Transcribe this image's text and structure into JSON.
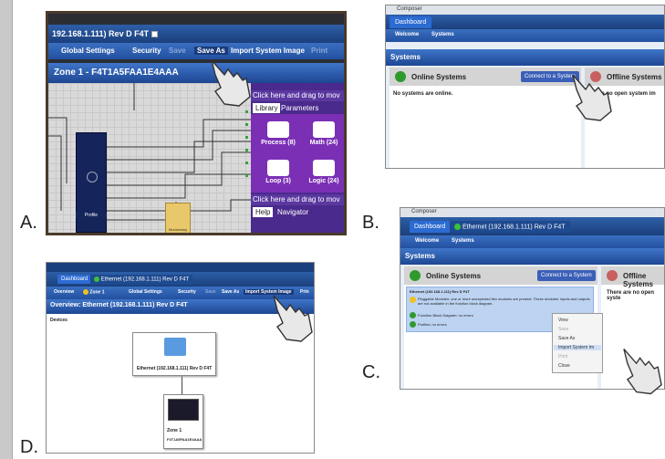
{
  "panel_letters": [
    "A.",
    "B.",
    "C.",
    "D."
  ],
  "panel_a": {
    "tab": "192.168.1.111) Rev D F4T",
    "menu": [
      "Global Settings",
      "Security",
      "Save",
      "Save As",
      "Import System Image",
      "Print"
    ],
    "zone_title": "Zone 1 - F4T1A5FAA1E4AAA",
    "drag_hint": "Click here and drag to mov",
    "lib_tab": "Library",
    "params_tab": "Parameters",
    "items": [
      "Process (8)",
      "Math (24)",
      "Loop (3)",
      "Logic (24)"
    ],
    "drag_hint2": "Click here and drag to mov",
    "help_tab": "Help",
    "nav_tab": "Navigator",
    "profile_label": "Profile",
    "momentary_label": "Momentary"
  },
  "panel_b": {
    "window_title": "Composer",
    "tab": "Dashboard",
    "menu": [
      "Welcome",
      "Systems"
    ],
    "section": "Systems",
    "online": "Online Systems",
    "connect_button": "Connect to a System",
    "offline": "Offline Systems",
    "no_online": "No systems are online.",
    "no_open": "re no open system im"
  },
  "panel_c": {
    "window_title": "Composer",
    "tab_dashboard": "Dashboard",
    "tab_ethernet": "Ethernet (192.168.1.111) Rev D F4T",
    "menu": [
      "Welcome",
      "Systems"
    ],
    "section": "Systems",
    "online": "Online Systems",
    "connect_button": "Connect to a System",
    "offline": "Offline Systems",
    "no_open": "There are no open syste",
    "entry_title": "Ethernet (192.168.1.111) Rev D F4T",
    "entry_warning": "Pluggable Modules: one or more unexpected flex modules are present. These modules' inputs and outputs are not available in the function block diagram.",
    "entry_fbd": "Function Block Diagram: no errors",
    "entry_profiles": "Profiles: no errors",
    "context_menu": [
      "View",
      "Save",
      "Save As",
      "Import System Im",
      "Print",
      "Close"
    ]
  },
  "panel_d": {
    "tab_dashboard": "Dashboard",
    "tab_ethernet": "Ethernet (192.168.1.111) Rev D F4T",
    "menu": [
      "Overview",
      "Zone 1",
      "Global Settings",
      "Security",
      "Save",
      "Save As",
      "Import System Image",
      "Prin"
    ],
    "overview_title": "Overview: Ethernet (192.168.1.111) Rev D F4T",
    "devices": "Devices",
    "node1": "Ethernet (192.168.1.111) Rev D F4T",
    "node2_line1": "Zone 1",
    "node2_line2": "F4T1A5FAA1E4AAA"
  },
  "colors": {
    "blue_bar": "#2350a0",
    "online_green": "#2e9a2e",
    "offline_red": "#c86060",
    "library_purple": "#7b2fb5"
  },
  "icons": [
    "pointing-hand-icon",
    "gear-icon",
    "green-status-icon",
    "warning-icon"
  ]
}
